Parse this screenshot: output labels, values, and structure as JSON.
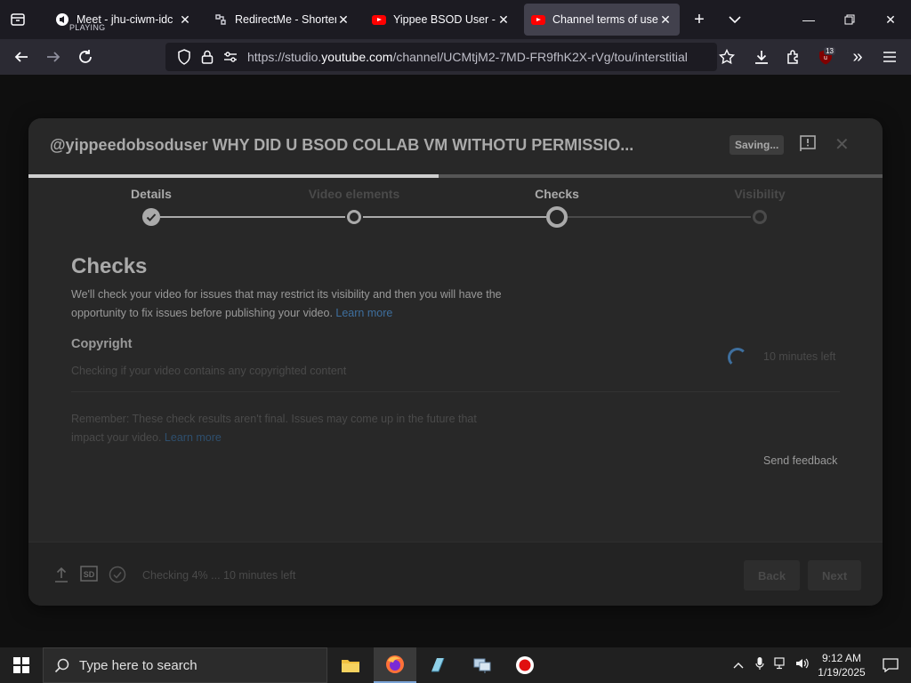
{
  "browser": {
    "tabs": [
      {
        "title": "Meet - jhu-ciwm-idc",
        "subtitle": "PLAYING",
        "active": false
      },
      {
        "title": "RedirectMe - Shorten y",
        "active": false
      },
      {
        "title": "Yippee BSOD User - Yo",
        "active": false
      },
      {
        "title": "Channel terms of use s",
        "active": true
      }
    ],
    "url_prefix": "https://studio.",
    "url_host": "youtube.com",
    "url_path": "/channel/UCMtjM2-7MD-FR9fhK2X-rVg/tou/interstitial",
    "extension_badge": "13"
  },
  "dialog": {
    "title": "@yippeedobsoduser WHY DID U BSOD COLLAB VM WITHOTU PERMISSIO...",
    "saving_label": "Saving...",
    "upload_progress": 0.48,
    "steps": [
      {
        "label": "Details",
        "state": "done"
      },
      {
        "label": "Video elements",
        "state": "visited"
      },
      {
        "label": "Checks",
        "state": "current"
      },
      {
        "label": "Visibility",
        "state": "pending"
      }
    ],
    "section_heading": "Checks",
    "intro_text": "We'll check your video for issues that may restrict its visibility and then you will have the opportunity to fix issues before publishing your video.",
    "intro_link": "Learn more",
    "copyright_heading": "Copyright",
    "copyright_status": "Checking if your video contains any copyrighted content",
    "time_left": "10 minutes left",
    "remember_text": "Remember: These check results aren't final. Issues may come up in the future that impact your video.",
    "remember_link": "Learn more",
    "send_feedback": "Send feedback",
    "footer_status": "Checking 4% ... 10 minutes left",
    "sd_badge": "SD",
    "back_label": "Back",
    "next_label": "Next"
  },
  "taskbar": {
    "search_placeholder": "Type here to search",
    "time": "9:12 AM",
    "date": "1/19/2025"
  }
}
